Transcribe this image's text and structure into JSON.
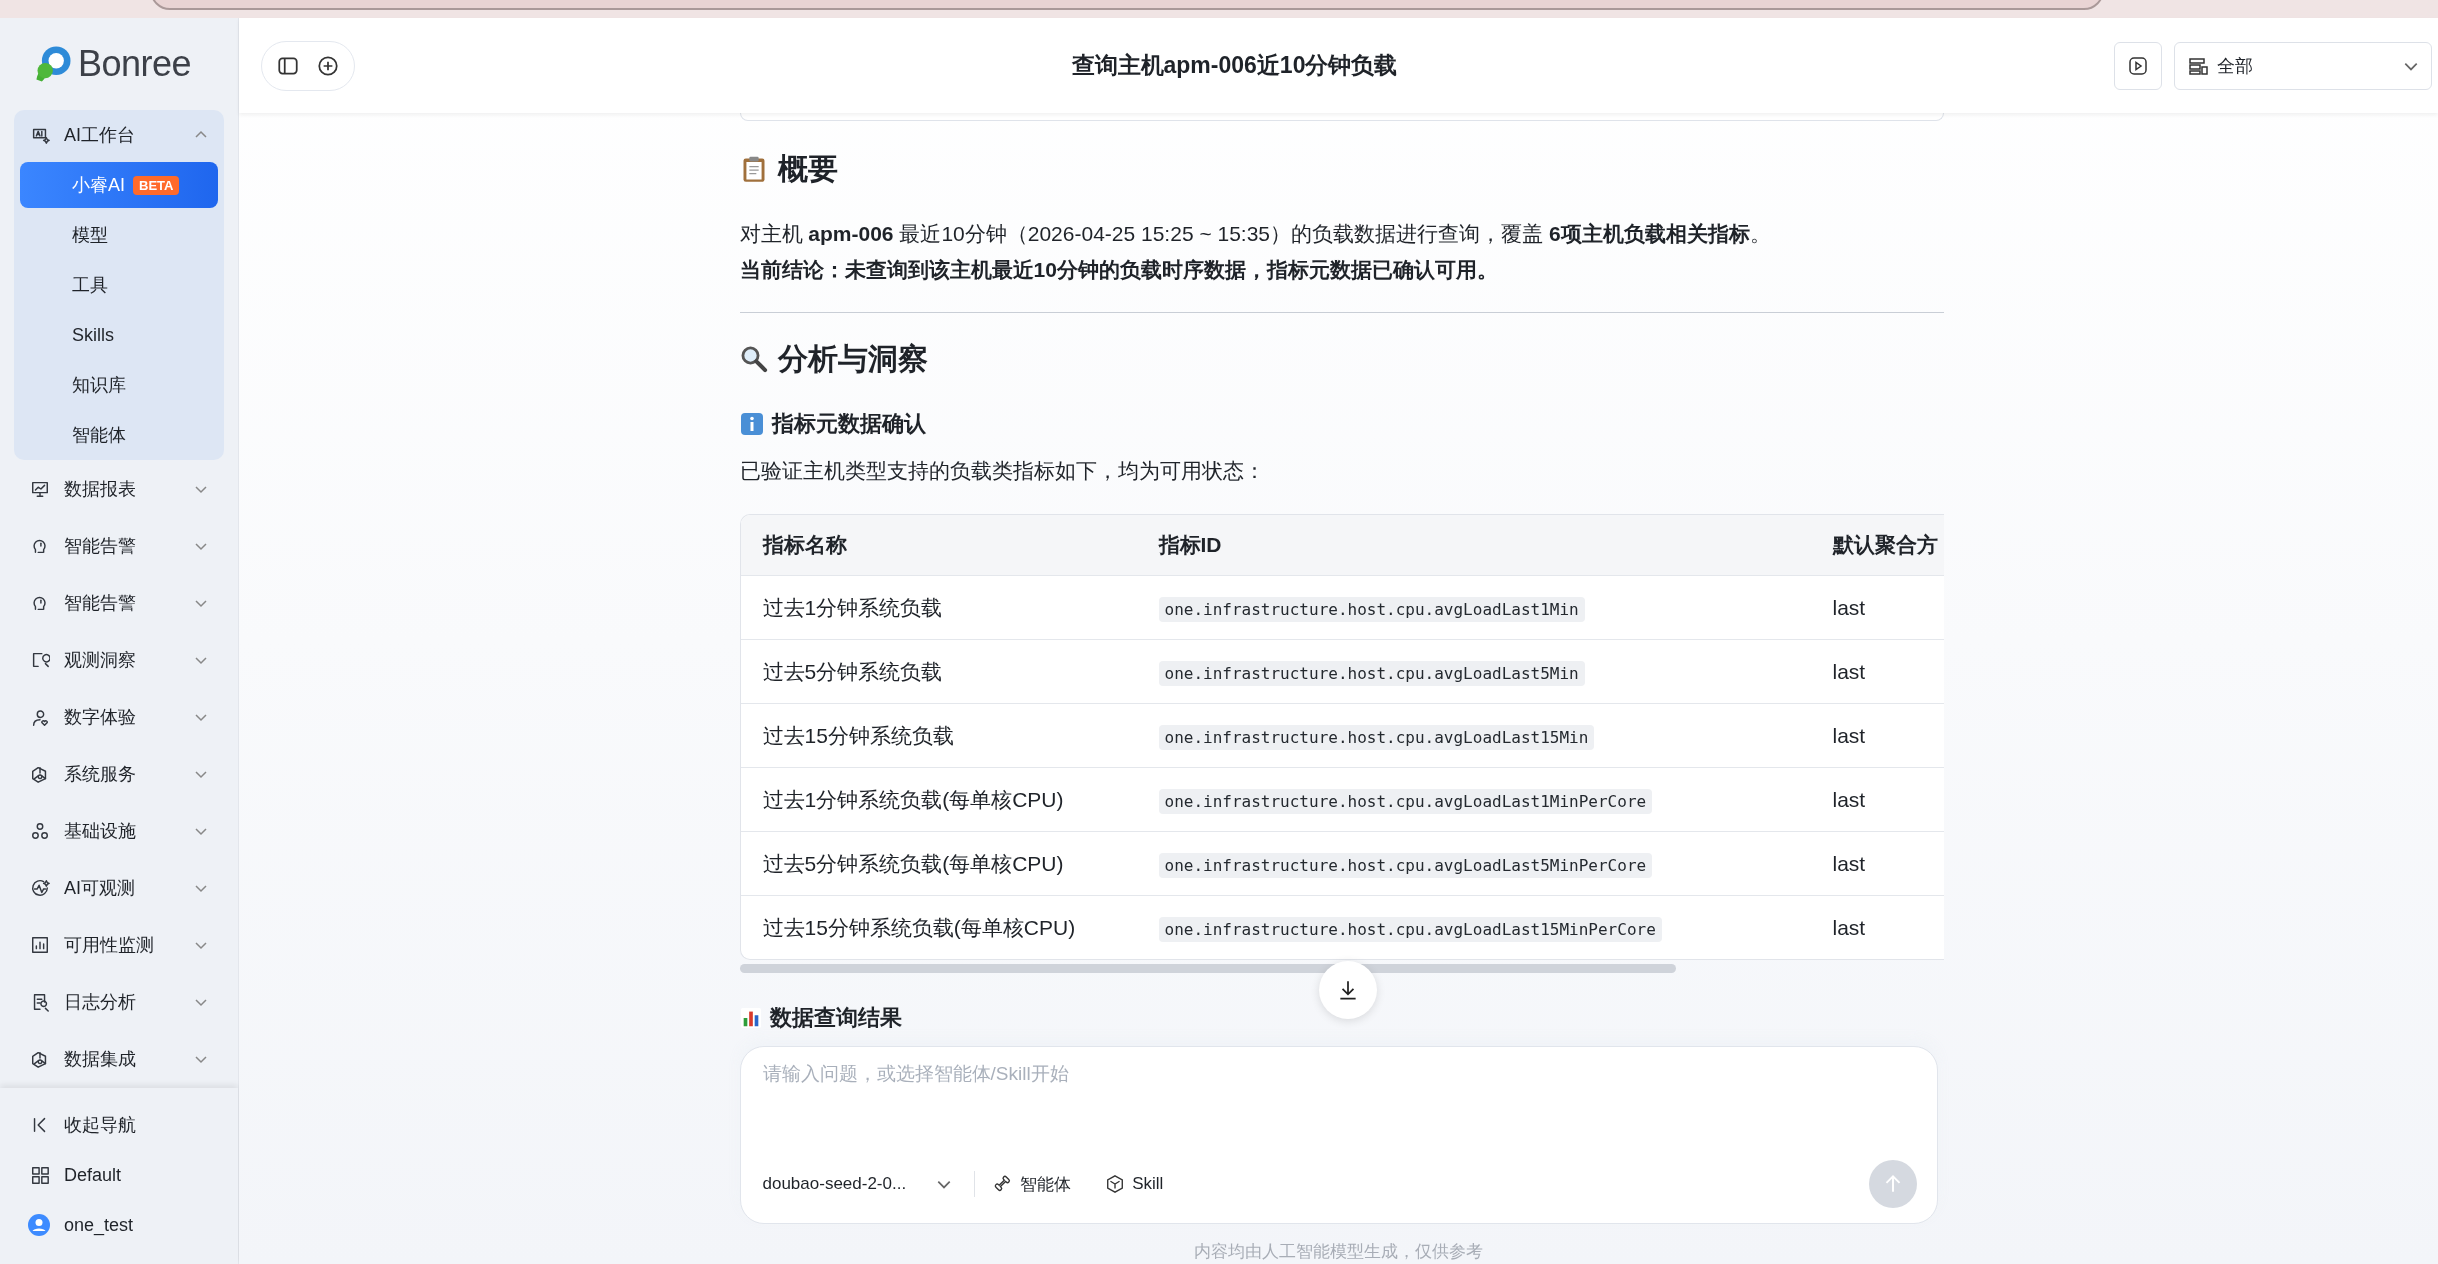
{
  "sidebar": {
    "logo": "Bonree",
    "nav": [
      {
        "label": "AI工作台",
        "expanded": true,
        "children": [
          {
            "label": "小睿AI",
            "badge": "BETA",
            "selected": true
          },
          {
            "label": "模型",
            "selected": false
          },
          {
            "label": "工具",
            "selected": false
          },
          {
            "label": "Skills",
            "selected": false
          },
          {
            "label": "知识库",
            "selected": false
          },
          {
            "label": "智能体",
            "selected": false
          }
        ]
      },
      {
        "label": "数据报表",
        "expanded": false
      },
      {
        "label": "智能告警",
        "expanded": false
      },
      {
        "label": "智能告警",
        "expanded": false
      },
      {
        "label": "观测洞察",
        "expanded": false
      },
      {
        "label": "数字体验",
        "expanded": false
      },
      {
        "label": "系统服务",
        "expanded": false
      },
      {
        "label": "基础设施",
        "expanded": false
      },
      {
        "label": "AI可观测",
        "expanded": false
      },
      {
        "label": "可用性监测",
        "expanded": false
      },
      {
        "label": "日志分析",
        "expanded": false
      },
      {
        "label": "数据集成",
        "expanded": false
      }
    ],
    "bottom": [
      "收起导航",
      "Default",
      "one_test"
    ]
  },
  "header": {
    "title": "查询主机apm-006近10分钟负载",
    "filter": "全部"
  },
  "content": {
    "summary_heading": "概要",
    "summary_text": "对主机 **apm-006** 最近10分钟（2026-04-25 15:25 ~ 15:35）的负载数据进行查询，覆盖 **6项主机负载相关指标**。",
    "conclusion": "当前结论：未查询到该主机最近10分钟的负载时序数据，指标元数据已确认可用。",
    "analysis_heading": "分析与洞察",
    "metadata_heading": "指标元数据确认",
    "metadata_text": "已验证主机类型支持的负载类指标如下，均为可用状态：",
    "table": {
      "columns": [
        "指标名称",
        "指标ID",
        "默认聚合方"
      ],
      "rows": [
        [
          "过去1分钟系统负载",
          "one.infrastructure.host.cpu.avgLoadLast1Min",
          "last"
        ],
        [
          "过去5分钟系统负载",
          "one.infrastructure.host.cpu.avgLoadLast5Min",
          "last"
        ],
        [
          "过去15分钟系统负载",
          "one.infrastructure.host.cpu.avgLoadLast15Min",
          "last"
        ],
        [
          "过去1分钟系统负载(每单核CPU)",
          "one.infrastructure.host.cpu.avgLoadLast1MinPerCore",
          "last"
        ],
        [
          "过去5分钟系统负载(每单核CPU)",
          "one.infrastructure.host.cpu.avgLoadLast5MinPerCore",
          "last"
        ],
        [
          "过去15分钟系统负载(每单核CPU)",
          "one.infrastructure.host.cpu.avgLoadLast15MinPerCore",
          "last"
        ]
      ]
    },
    "results_heading": "数据查询结果"
  },
  "composer": {
    "placeholder": "请输入问题，或选择智能体/Skill开始",
    "model": "doubao-seed-2-0...",
    "agent_button": "智能体",
    "skill_button": "Skill"
  },
  "footer_note": "内容均由人工智能模型生成，仅供参考"
}
